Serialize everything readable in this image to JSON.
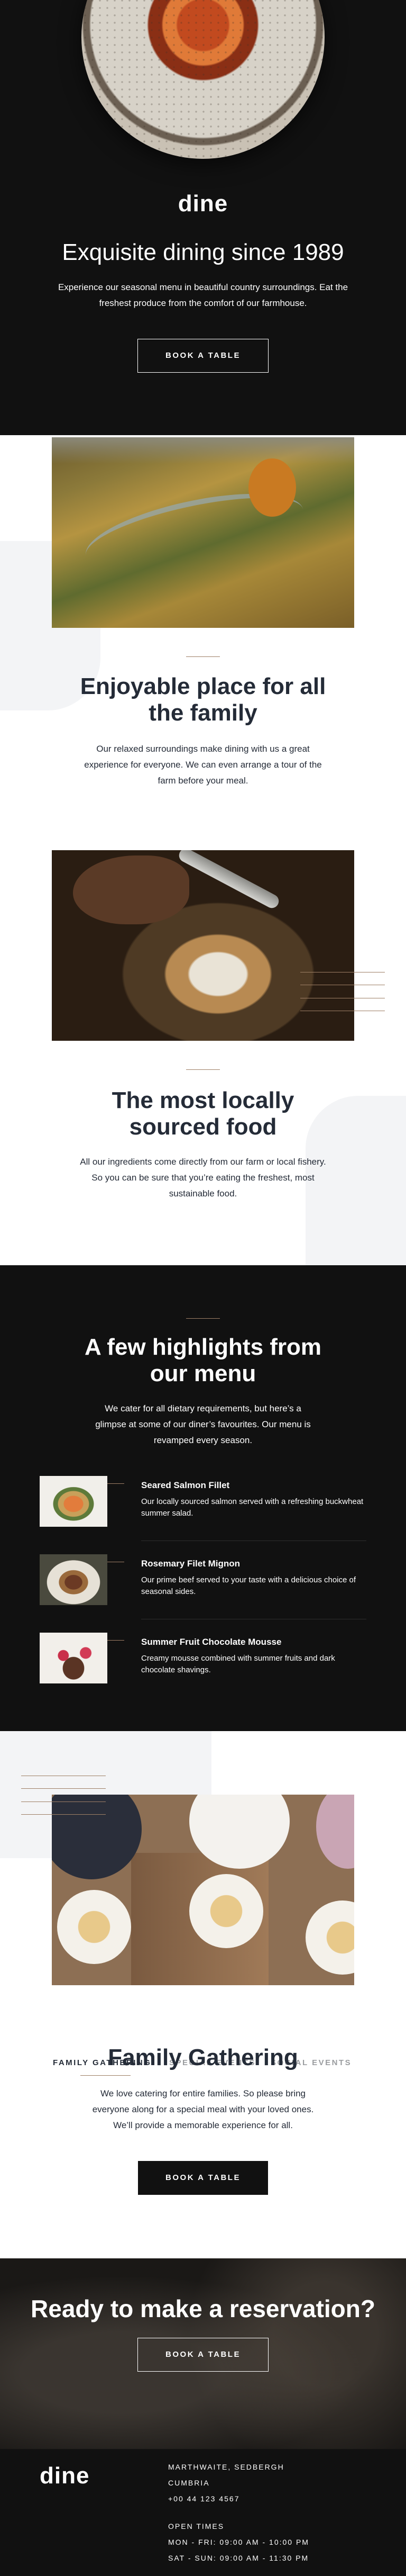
{
  "brand": {
    "logo": "dine",
    "accent": "#9e7f66",
    "dark": "#111111",
    "text": "#242b37"
  },
  "hero": {
    "title": "Exquisite dining since 1989",
    "text": "Experience our seasonal menu in beautiful country surroundings. Eat the freshest produce from the comfort of our farmhouse.",
    "button": "BOOK A TABLE"
  },
  "features": [
    {
      "title": "Enjoyable place for all the family",
      "text": "Our relaxed surroundings make dining with us a great experience for everyone. We can even arrange a tour of the farm before your meal."
    },
    {
      "title": "The most locally sourced food",
      "text": "All our ingredients come directly from our farm or local fishery. So you can be sure that you’re eating the freshest, most sustainable food."
    }
  ],
  "highlights": {
    "title": "A few highlights from our menu",
    "text": "We cater for all dietary requirements, but here’s a glimpse at some of our diner’s favourites. Our menu is revamped every season.",
    "items": [
      {
        "name": "Seared Salmon Fillet",
        "desc": "Our locally sourced salmon served with a refreshing buckwheat summer salad."
      },
      {
        "name": "Rosemary Filet Mignon",
        "desc": "Our prime beef served to your taste with a delicious choice of seasonal sides."
      },
      {
        "name": "Summer Fruit Chocolate Mousse",
        "desc": "Creamy mousse combined with summer fruits and dark chocolate shavings."
      }
    ]
  },
  "events": {
    "tabs": [
      "FAMILY GATHERING",
      "SPECIAL EVENTS",
      "SOCIAL EVENTS"
    ],
    "active_tab": "FAMILY GATHERING",
    "title": "Family Gathering",
    "text": "We love catering for entire families. So please bring everyone along for a special meal with your loved ones. We’ll provide a memorable experience for all.",
    "button": "BOOK A TABLE"
  },
  "reservation": {
    "title": "Ready to make a reservation?",
    "button": "BOOK A TABLE"
  },
  "footer": {
    "address": [
      "MARTHWAITE, SEDBERGH",
      "CUMBRIA",
      "+00 44 123 4567"
    ],
    "hours_title": "OPEN TIMES",
    "hours": [
      "MON - FRI: 09:00 AM - 10:00 PM",
      "SAT - SUN: 09:00 AM - 11:30 PM"
    ]
  }
}
